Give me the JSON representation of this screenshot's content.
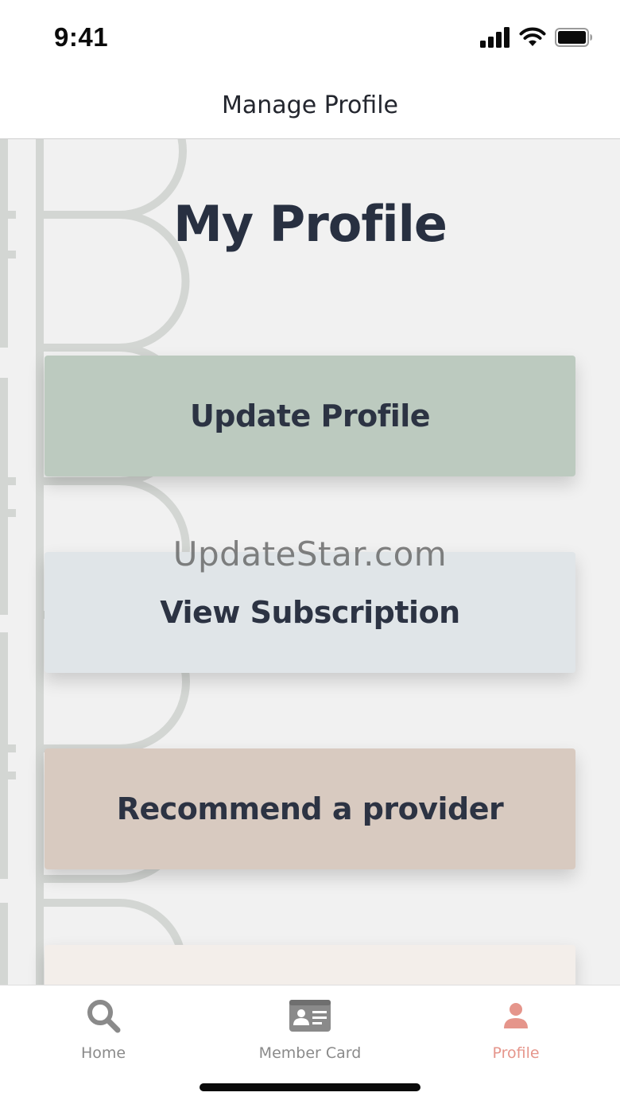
{
  "status_bar": {
    "time": "9:41",
    "icons": [
      "signal-icon",
      "wifi-icon",
      "battery-icon"
    ]
  },
  "header": {
    "title": "Manage Profile"
  },
  "main": {
    "heading": "My Profile",
    "actions": [
      {
        "label": "Update Profile",
        "color": "#bccabf"
      },
      {
        "label": "View Subscription",
        "color": "#e0e5e8"
      },
      {
        "label": "Recommend a provider",
        "color": "#d8cac0"
      },
      {
        "label": "",
        "color": "#f3eeea"
      }
    ],
    "watermark": "UpdateStar.com"
  },
  "tab_bar": {
    "tabs": [
      {
        "label": "Home",
        "icon": "search-icon",
        "active": false
      },
      {
        "label": "Member Card",
        "icon": "id-card-icon",
        "active": false
      },
      {
        "label": "Profile",
        "icon": "person-icon",
        "active": true
      }
    ]
  },
  "colors": {
    "accent": "#e5958b",
    "text": "#283041",
    "background": "#f1f1f1"
  }
}
